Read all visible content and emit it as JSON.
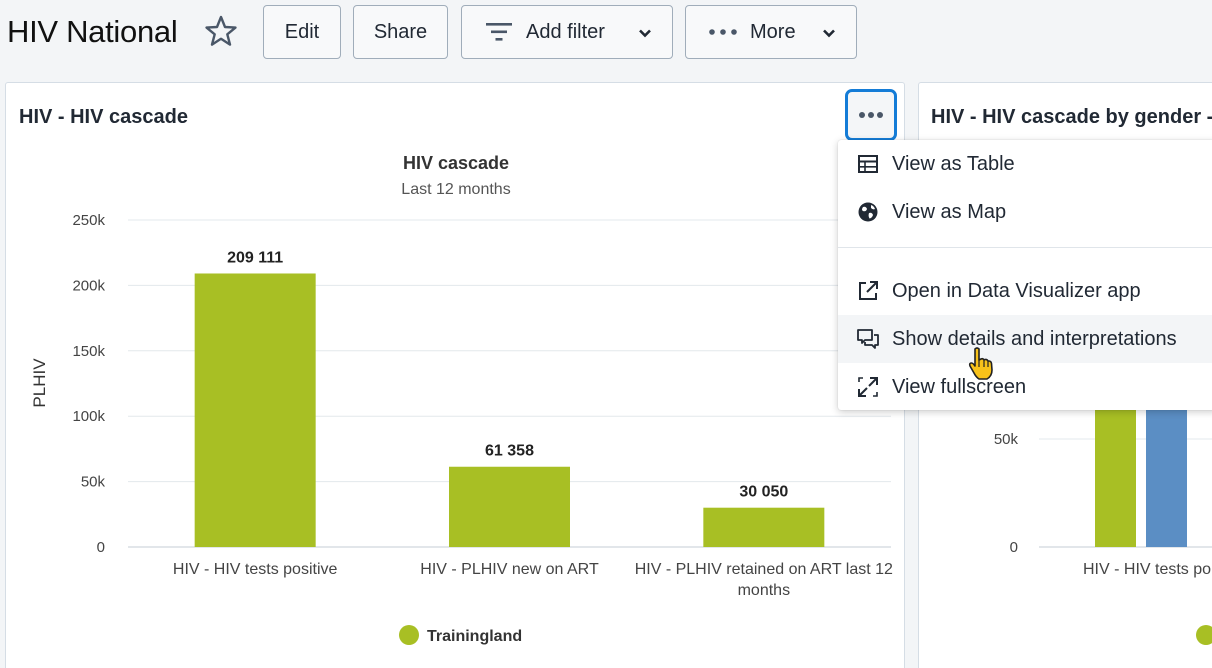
{
  "dashboard": {
    "title": "HIV National"
  },
  "toolbar": {
    "edit_label": "Edit",
    "share_label": "Share",
    "filter_label": "Add filter",
    "more_label": "More"
  },
  "card1": {
    "title": "HIV - HIV cascade"
  },
  "card2": {
    "title": "HIV - HIV cascade by gender -",
    "y_ticks": [
      "50k",
      "0"
    ],
    "category": "HIV - HIV tests po"
  },
  "menu": {
    "items": [
      {
        "label": "View as Table",
        "icon": "table-icon"
      },
      {
        "label": "View as Map",
        "icon": "globe-icon"
      },
      {
        "label": "Open in Data Visualizer app",
        "icon": "external-link-icon"
      },
      {
        "label": "Show details and interpretations",
        "icon": "chat-bubbles-icon"
      },
      {
        "label": "View fullscreen",
        "icon": "fullscreen-icon"
      }
    ]
  },
  "colors": {
    "bar_green": "#a8bf24",
    "bar_blue": "#5b8ec4",
    "focus_blue": "#147cd7"
  },
  "chart_data": [
    {
      "type": "bar",
      "title": "HIV cascade",
      "subtitle": "Last 12 months",
      "ylabel": "PLHIV",
      "xlabel": "",
      "categories": [
        "HIV - HIV tests positive",
        "HIV - PLHIV new on ART",
        "HIV - PLHIV retained on ART last 12 months"
      ],
      "series": [
        {
          "name": "Trainingland",
          "values": [
            209111,
            61358,
            30050
          ],
          "color": "#a8bf24"
        }
      ],
      "data_labels": [
        "209 111",
        "61 358",
        "30 050"
      ],
      "y_ticks": [
        "0",
        "50k",
        "100k",
        "150k",
        "200k",
        "250k"
      ],
      "ylim": [
        0,
        250000
      ],
      "grid": true,
      "legend": "bottom-center"
    }
  ]
}
